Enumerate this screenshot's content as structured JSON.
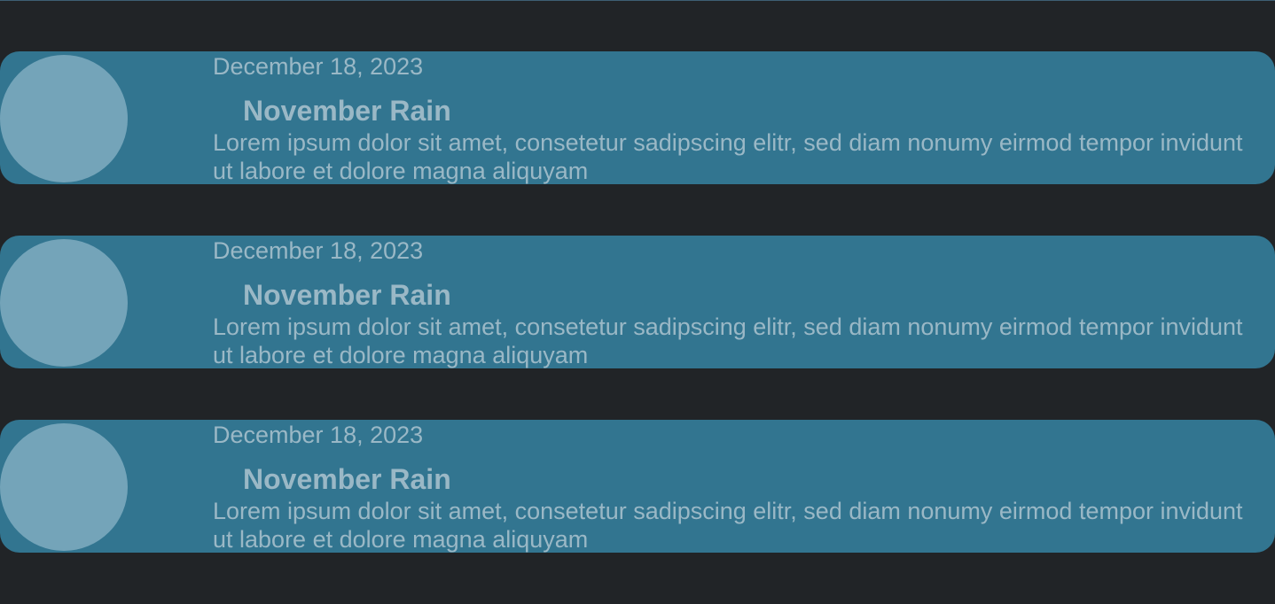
{
  "colors": {
    "page_background": "#212427",
    "card_background": "#327590",
    "avatar_placeholder": "#74a4b9",
    "text": "#9ab8c6"
  },
  "posts": [
    {
      "date": "December 18, 2023",
      "title": "November Rain",
      "excerpt": "Lorem ipsum dolor sit amet, consetetur sadipscing elitr, sed diam nonumy eirmod tempor invidunt ut labore et dolore magna aliquyam"
    },
    {
      "date": "December 18, 2023",
      "title": "November Rain",
      "excerpt": "Lorem ipsum dolor sit amet, consetetur sadipscing elitr, sed diam nonumy eirmod tempor invidunt ut labore et dolore magna aliquyam"
    },
    {
      "date": "December 18, 2023",
      "title": "November Rain",
      "excerpt": "Lorem ipsum dolor sit amet, consetetur sadipscing elitr, sed diam nonumy eirmod tempor invidunt ut labore et dolore magna aliquyam"
    }
  ]
}
